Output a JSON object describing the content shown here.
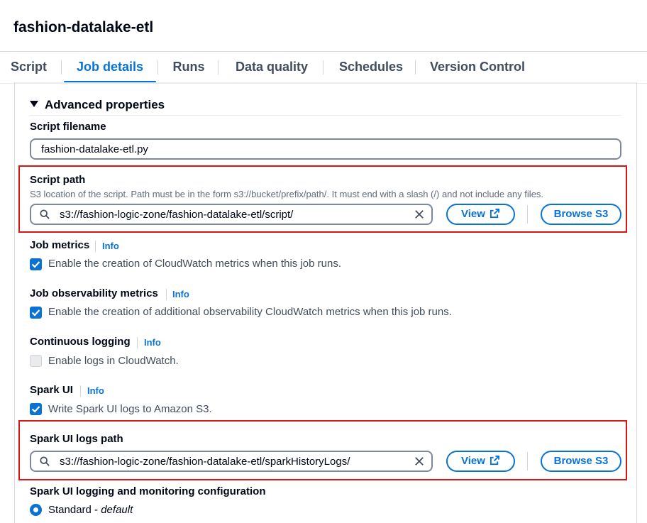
{
  "page": {
    "title": "fashion-datalake-etl"
  },
  "tabs": [
    "Script",
    "Job details",
    "Runs",
    "Data quality",
    "Schedules",
    "Version Control"
  ],
  "active_tab": "Job details",
  "advanced": {
    "heading": "Advanced properties"
  },
  "script_filename": {
    "label": "Script filename",
    "value": "fashion-datalake-etl.py"
  },
  "script_path": {
    "label": "Script path",
    "description": "S3 location of the script. Path must be in the form s3://bucket/prefix/path/. It must end with a slash (/) and not include any files.",
    "value": "s3://fashion-logic-zone/fashion-datalake-etl/script/",
    "view_label": "View",
    "browse_label": "Browse S3"
  },
  "info_label": "Info",
  "job_metrics": {
    "label": "Job metrics",
    "checkbox": "Enable the creation of CloudWatch metrics when this job runs.",
    "checked": true
  },
  "job_observability": {
    "label": "Job observability metrics",
    "checkbox": "Enable the creation of additional observability CloudWatch metrics when this job runs.",
    "checked": true
  },
  "continuous_logging": {
    "label": "Continuous logging",
    "checkbox": "Enable logs in CloudWatch.",
    "checked": false
  },
  "spark_ui": {
    "label": "Spark UI",
    "checkbox": "Write Spark UI logs to Amazon S3.",
    "checked": true
  },
  "spark_ui_logs_path": {
    "label": "Spark UI logs path",
    "value": "s3://fashion-logic-zone/fashion-datalake-etl/sparkHistoryLogs/",
    "view_label": "View",
    "browse_label": "Browse S3"
  },
  "spark_ui_config": {
    "label": "Spark UI logging and monitoring configuration",
    "option_standard": "Standard - ",
    "option_default": "default"
  },
  "colors": {
    "accent": "#0972d3",
    "highlight": "#d91515",
    "text": "#000716"
  },
  "icons": {
    "search": "search-icon",
    "clear": "close-icon",
    "external": "external-link-icon",
    "caret": "caret-down-icon",
    "check": "check-icon"
  }
}
